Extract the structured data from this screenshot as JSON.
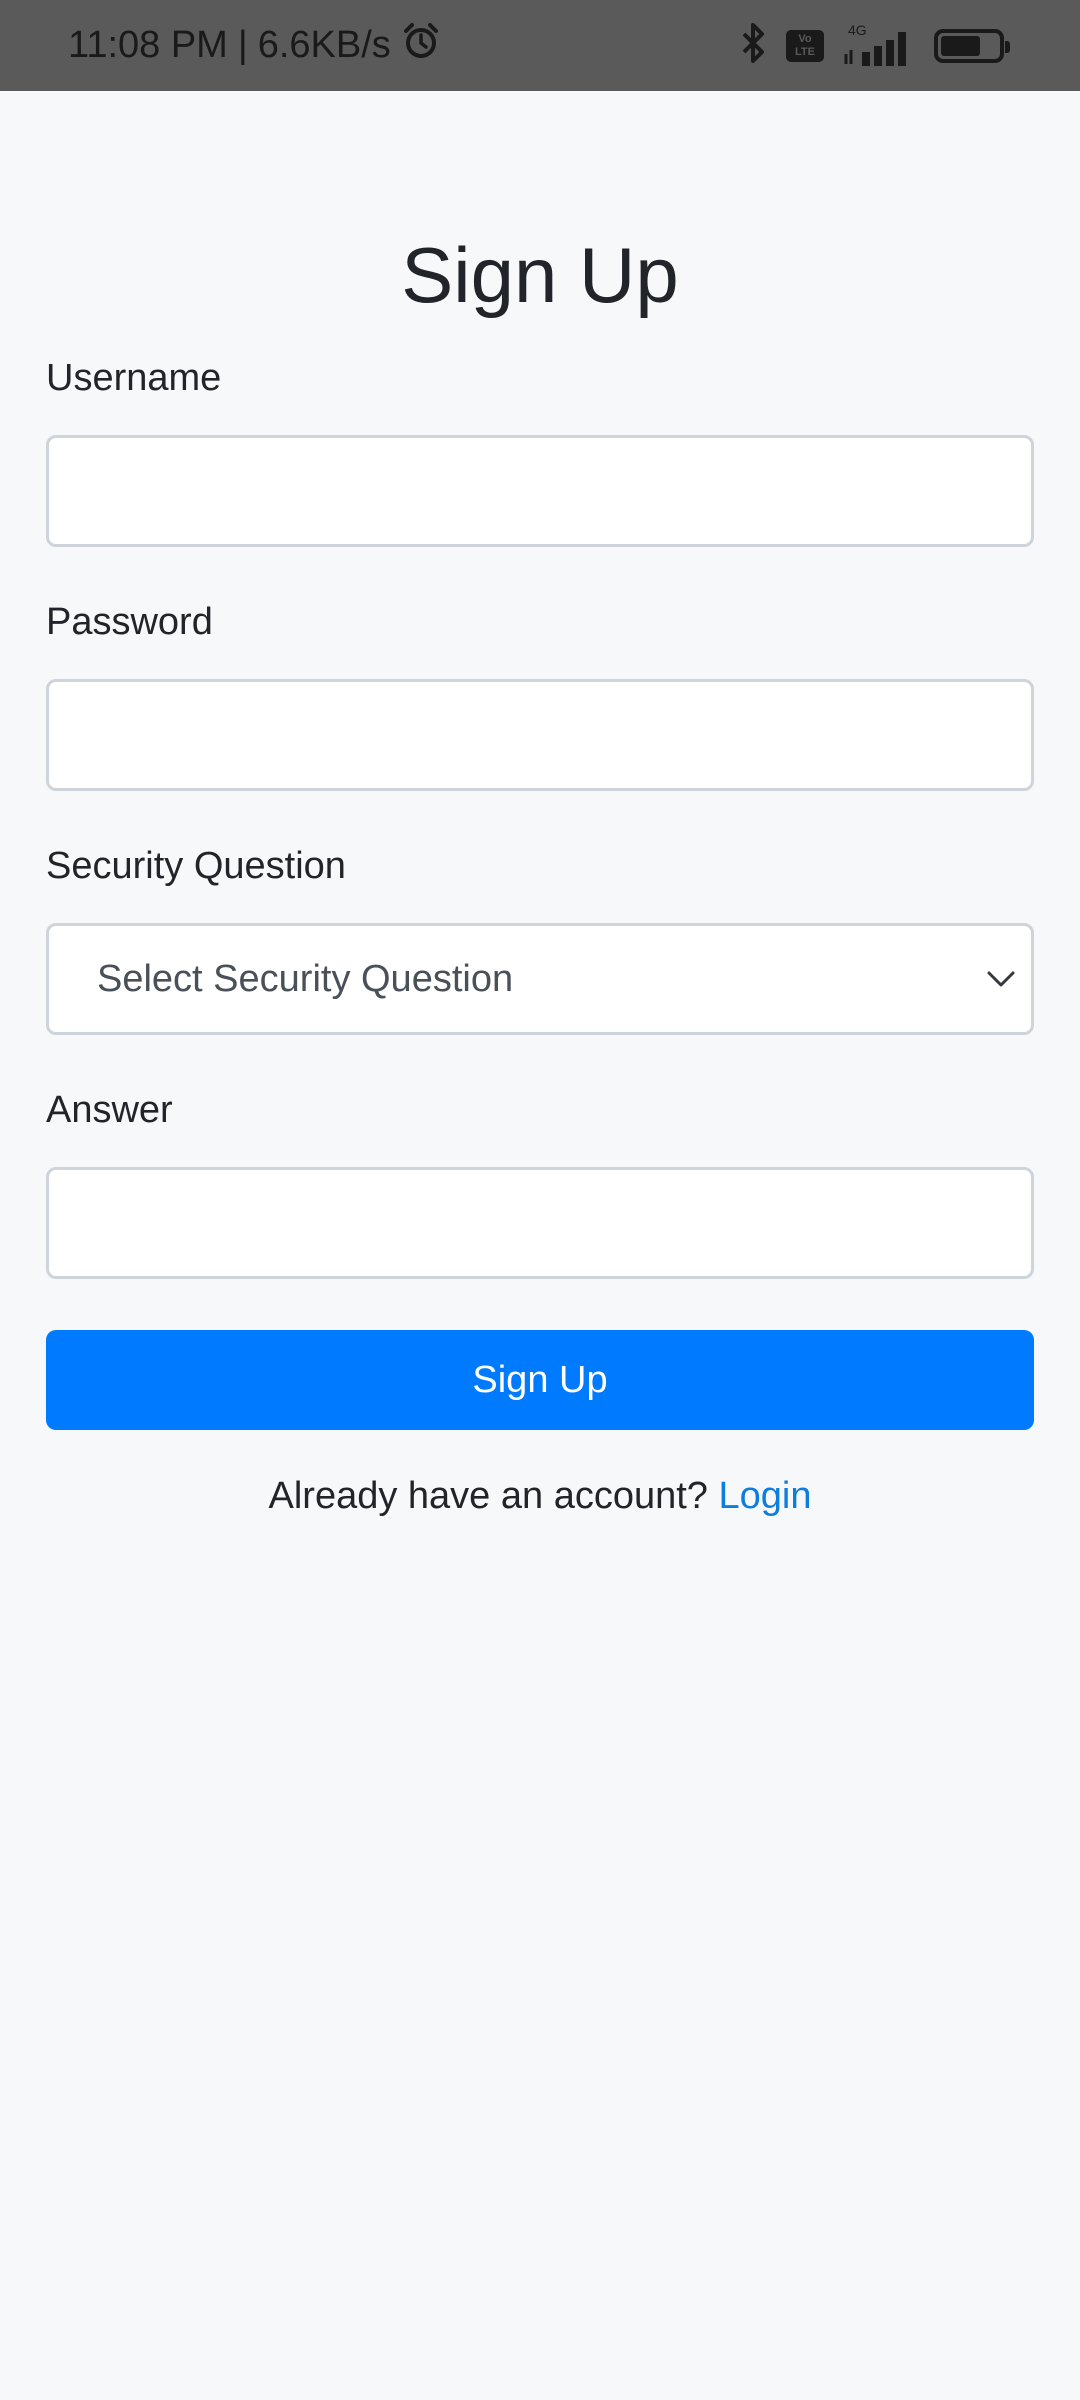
{
  "status_bar": {
    "time": "11:08 PM",
    "separator": "|",
    "speed": "6.6KB/s",
    "volte": "Vo\nLTE",
    "network": "4G",
    "icons": [
      "alarm-icon",
      "bluetooth-icon",
      "volte-icon",
      "signal-icon",
      "battery-icon"
    ]
  },
  "form": {
    "title": "Sign Up",
    "username_label": "Username",
    "username_value": "",
    "password_label": "Password",
    "password_value": "",
    "security_label": "Security Question",
    "security_selected": "Select Security Question",
    "answer_label": "Answer",
    "answer_value": "",
    "submit_label": "Sign Up"
  },
  "footer": {
    "prompt": "Already have an account?",
    "link": "Login"
  },
  "colors": {
    "primary": "#007bff",
    "link": "#0d7ddf",
    "background": "#f7f8fa",
    "status_bar": "#5a5a5a"
  }
}
